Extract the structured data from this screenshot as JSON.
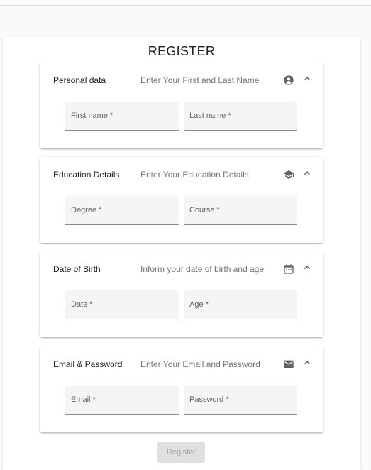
{
  "form": {
    "title": "REGISTER",
    "submit_label": "Register"
  },
  "panels": [
    {
      "title": "Personal data",
      "description": "Enter Your First and Last Name",
      "icon": "account-circle-icon",
      "fields": [
        {
          "label": "First name *"
        },
        {
          "label": "Last name *"
        }
      ]
    },
    {
      "title": "Education Details",
      "description": "Enter Your Education Details",
      "icon": "school-icon",
      "fields": [
        {
          "label": "Degree *"
        },
        {
          "label": "Course *"
        }
      ]
    },
    {
      "title": "Date of Birth",
      "description": "Inform your date of birth and age",
      "icon": "calendar-icon",
      "fields": [
        {
          "label": "Date *"
        },
        {
          "label": "Age *"
        }
      ]
    },
    {
      "title": "Email & Password",
      "description": "Enter Your Email and Password",
      "icon": "mail-icon",
      "fields": [
        {
          "label": "Email *"
        },
        {
          "label": "Password *"
        }
      ]
    }
  ],
  "colors": {
    "icon": "#616161",
    "field_background": "#f5f5f5",
    "button_background": "#e0e0e0",
    "button_text": "#a6a6a6"
  }
}
